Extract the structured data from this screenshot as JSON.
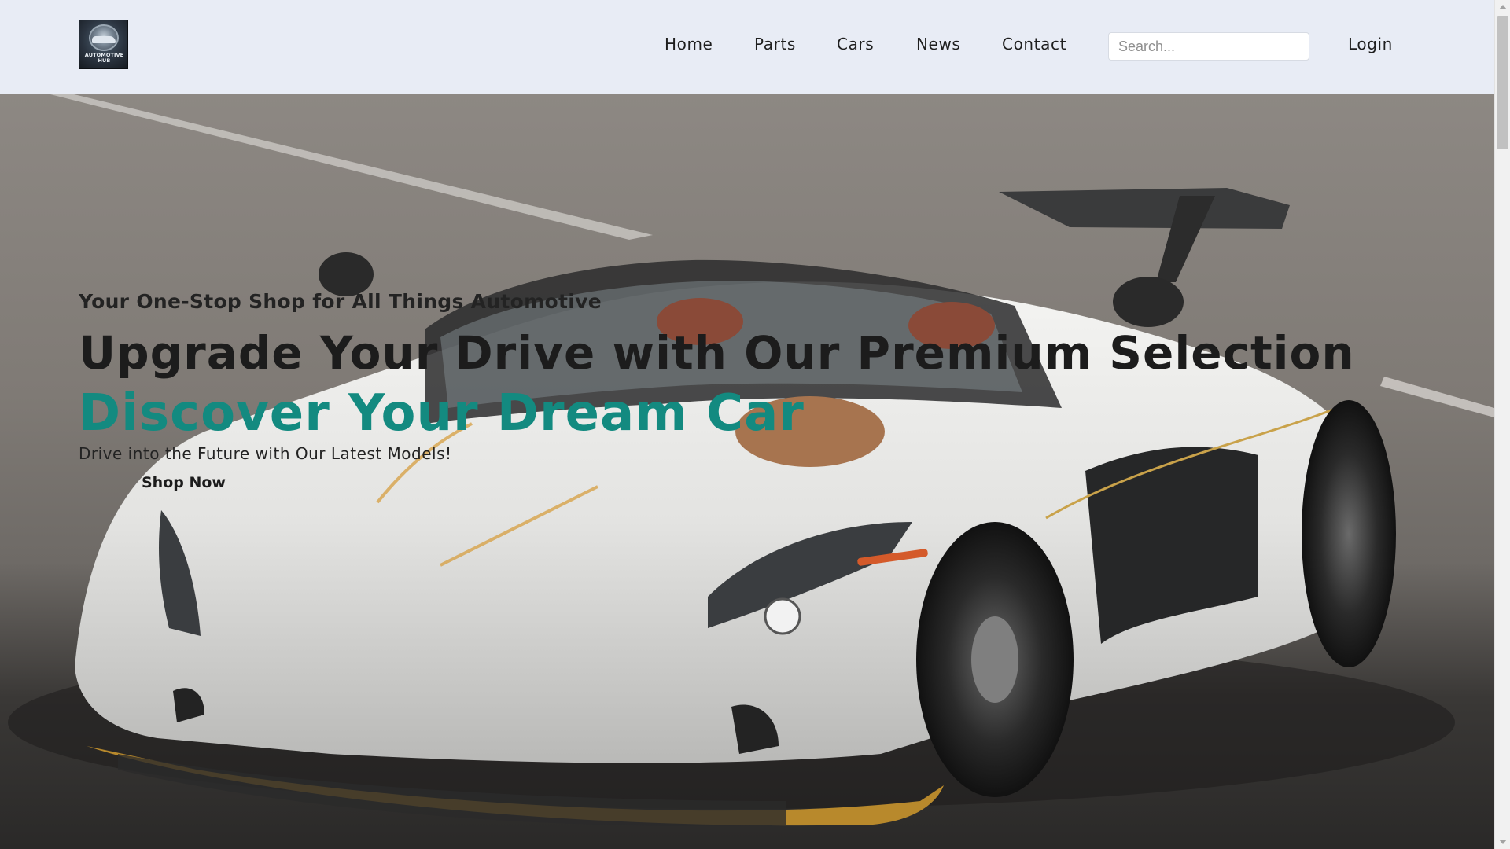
{
  "header": {
    "logo": {
      "text_line1": "AUTOMOTIVE",
      "text_line2": "HUB",
      "icon": "logo-emblem-icon"
    },
    "nav": [
      {
        "label": "Home"
      },
      {
        "label": "Parts"
      },
      {
        "label": "Cars"
      },
      {
        "label": "News"
      },
      {
        "label": "Contact"
      }
    ],
    "search": {
      "placeholder": "Search...",
      "value": ""
    },
    "login_label": "Login"
  },
  "hero": {
    "tagline": "Your One-Stop Shop for All Things Automotive",
    "headline": "Upgrade Your Drive with Our Premium Selection",
    "subheadline": "Discover Your Dream Car",
    "description": "Drive into the Future with Our Latest Models!",
    "cta_label": "Shop Now",
    "image": "white-supercar-on-asphalt"
  },
  "colors": {
    "header_bg": "#e8ecf5",
    "accent_teal": "#138a80",
    "text_dark": "#1c1c1c"
  }
}
